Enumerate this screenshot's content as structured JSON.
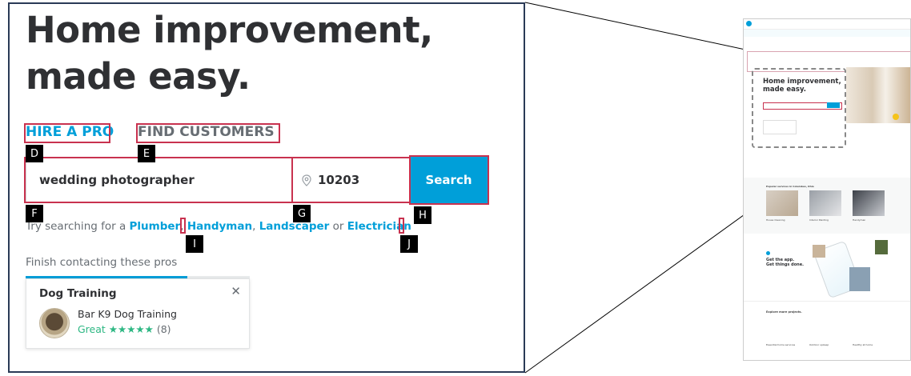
{
  "hero": {
    "headline_line1": "Home improvement,",
    "headline_line2": "made easy."
  },
  "tabs": {
    "hire_label": "HIRE A PRO",
    "find_label": "FIND CUSTOMERS"
  },
  "search": {
    "query": "wedding photographer",
    "zip": "10203",
    "button_label": "Search"
  },
  "suggestions": {
    "prefix": "Try searching for a",
    "links": [
      "Plumber",
      "Handyman",
      "Landscaper",
      "Electrician"
    ],
    "separator": ", ",
    "or_text": " or "
  },
  "recent": {
    "label": "Finish contacting these pros",
    "progress_percent": 72,
    "card": {
      "title": "Dog Training",
      "pro_name": "Bar K9 Dog Training",
      "rating_text": "Great",
      "stars": "★★★★★",
      "review_count": "(8)"
    }
  },
  "markers": {
    "D": "D",
    "E": "E",
    "F": "F",
    "G": "G",
    "H": "H",
    "I": "I",
    "J": "J"
  },
  "icons": {
    "close": "close-icon",
    "location": "location-pin-icon",
    "star": "star-icon"
  },
  "colors": {
    "brand_blue": "#009fd9",
    "marker_red": "#c8324f",
    "rating_green": "#2db783",
    "frame_navy": "#2a3a56"
  },
  "overview": {
    "headline_line1": "Home improvement,",
    "headline_line2": "made easy.",
    "section_popular": "Popular services in Columbus, Ohio",
    "service_1": "House Cleaning",
    "service_2": "Interior Painting",
    "service_3": "Handyman",
    "app_line1": "Get the app.",
    "app_line2": "Get things done.",
    "explore": "Explore more projects.",
    "footer_1": "Essential home services",
    "footer_2": "Outdoor upkeep",
    "footer_3": "Healthy at home"
  }
}
